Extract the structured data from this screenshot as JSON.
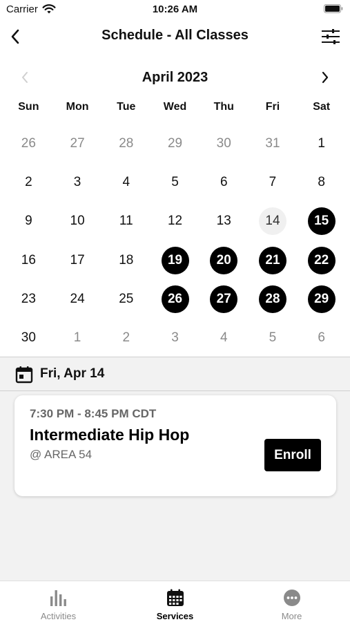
{
  "status_bar": {
    "carrier": "Carrier",
    "time": "10:26 AM"
  },
  "nav": {
    "title": "Schedule - All Classes",
    "back_icon": "chevron-left-icon",
    "filter_icon": "sliders-icon"
  },
  "calendar": {
    "month_label": "April 2023",
    "weekdays": [
      "Sun",
      "Mon",
      "Tue",
      "Wed",
      "Thu",
      "Fri",
      "Sat"
    ],
    "weeks": [
      [
        {
          "d": "26",
          "s": "muted"
        },
        {
          "d": "27",
          "s": "muted"
        },
        {
          "d": "28",
          "s": "muted"
        },
        {
          "d": "29",
          "s": "muted"
        },
        {
          "d": "30",
          "s": "muted"
        },
        {
          "d": "31",
          "s": "muted"
        },
        {
          "d": "1",
          "s": ""
        }
      ],
      [
        {
          "d": "2",
          "s": ""
        },
        {
          "d": "3",
          "s": ""
        },
        {
          "d": "4",
          "s": ""
        },
        {
          "d": "5",
          "s": ""
        },
        {
          "d": "6",
          "s": ""
        },
        {
          "d": "7",
          "s": ""
        },
        {
          "d": "8",
          "s": ""
        }
      ],
      [
        {
          "d": "9",
          "s": ""
        },
        {
          "d": "10",
          "s": ""
        },
        {
          "d": "11",
          "s": ""
        },
        {
          "d": "12",
          "s": ""
        },
        {
          "d": "13",
          "s": ""
        },
        {
          "d": "14",
          "s": "selected"
        },
        {
          "d": "15",
          "s": "event"
        }
      ],
      [
        {
          "d": "16",
          "s": ""
        },
        {
          "d": "17",
          "s": ""
        },
        {
          "d": "18",
          "s": ""
        },
        {
          "d": "19",
          "s": "event"
        },
        {
          "d": "20",
          "s": "event"
        },
        {
          "d": "21",
          "s": "event"
        },
        {
          "d": "22",
          "s": "event"
        }
      ],
      [
        {
          "d": "23",
          "s": ""
        },
        {
          "d": "24",
          "s": ""
        },
        {
          "d": "25",
          "s": ""
        },
        {
          "d": "26",
          "s": "event"
        },
        {
          "d": "27",
          "s": "event"
        },
        {
          "d": "28",
          "s": "event"
        },
        {
          "d": "29",
          "s": "event"
        }
      ],
      [
        {
          "d": "30",
          "s": ""
        },
        {
          "d": "1",
          "s": "muted"
        },
        {
          "d": "2",
          "s": "muted"
        },
        {
          "d": "3",
          "s": "muted"
        },
        {
          "d": "4",
          "s": "muted"
        },
        {
          "d": "5",
          "s": "muted"
        },
        {
          "d": "6",
          "s": "muted"
        }
      ]
    ]
  },
  "selected_date": {
    "label": "Fri, Apr 14",
    "icon": "calendar-icon"
  },
  "classes": [
    {
      "time": "7:30 PM - 8:45 PM CDT",
      "name": "Intermediate Hip Hop",
      "location": "@ AREA 54",
      "action_label": "Enroll"
    }
  ],
  "tabs": [
    {
      "label": "Activities",
      "icon": "bar-chart-icon",
      "active": false
    },
    {
      "label": "Services",
      "icon": "calendar-grid-icon",
      "active": true
    },
    {
      "label": "More",
      "icon": "more-dots-icon",
      "active": false
    }
  ],
  "colors": {
    "accent": "#000000",
    "muted_text": "#8a8a8a",
    "panel_background": "#f2f2f2"
  }
}
